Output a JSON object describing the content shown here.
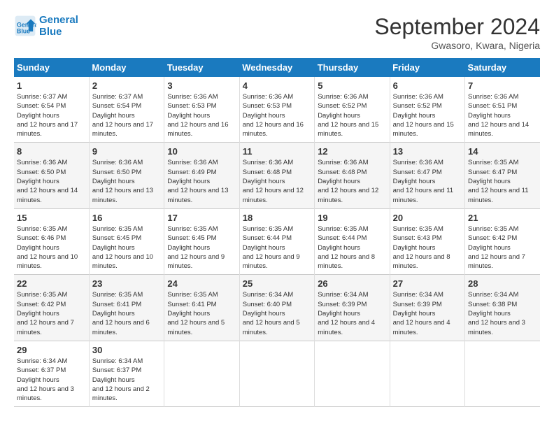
{
  "header": {
    "logo_line1": "General",
    "logo_line2": "Blue",
    "month": "September 2024",
    "location": "Gwasoro, Kwara, Nigeria"
  },
  "columns": [
    "Sunday",
    "Monday",
    "Tuesday",
    "Wednesday",
    "Thursday",
    "Friday",
    "Saturday"
  ],
  "weeks": [
    [
      {
        "day": "1",
        "sunrise": "6:37 AM",
        "sunset": "6:54 PM",
        "daylight": "12 hours and 17 minutes."
      },
      {
        "day": "2",
        "sunrise": "6:37 AM",
        "sunset": "6:54 PM",
        "daylight": "12 hours and 17 minutes."
      },
      {
        "day": "3",
        "sunrise": "6:36 AM",
        "sunset": "6:53 PM",
        "daylight": "12 hours and 16 minutes."
      },
      {
        "day": "4",
        "sunrise": "6:36 AM",
        "sunset": "6:53 PM",
        "daylight": "12 hours and 16 minutes."
      },
      {
        "day": "5",
        "sunrise": "6:36 AM",
        "sunset": "6:52 PM",
        "daylight": "12 hours and 15 minutes."
      },
      {
        "day": "6",
        "sunrise": "6:36 AM",
        "sunset": "6:52 PM",
        "daylight": "12 hours and 15 minutes."
      },
      {
        "day": "7",
        "sunrise": "6:36 AM",
        "sunset": "6:51 PM",
        "daylight": "12 hours and 14 minutes."
      }
    ],
    [
      {
        "day": "8",
        "sunrise": "6:36 AM",
        "sunset": "6:50 PM",
        "daylight": "12 hours and 14 minutes."
      },
      {
        "day": "9",
        "sunrise": "6:36 AM",
        "sunset": "6:50 PM",
        "daylight": "12 hours and 13 minutes."
      },
      {
        "day": "10",
        "sunrise": "6:36 AM",
        "sunset": "6:49 PM",
        "daylight": "12 hours and 13 minutes."
      },
      {
        "day": "11",
        "sunrise": "6:36 AM",
        "sunset": "6:48 PM",
        "daylight": "12 hours and 12 minutes."
      },
      {
        "day": "12",
        "sunrise": "6:36 AM",
        "sunset": "6:48 PM",
        "daylight": "12 hours and 12 minutes."
      },
      {
        "day": "13",
        "sunrise": "6:36 AM",
        "sunset": "6:47 PM",
        "daylight": "12 hours and 11 minutes."
      },
      {
        "day": "14",
        "sunrise": "6:35 AM",
        "sunset": "6:47 PM",
        "daylight": "12 hours and 11 minutes."
      }
    ],
    [
      {
        "day": "15",
        "sunrise": "6:35 AM",
        "sunset": "6:46 PM",
        "daylight": "12 hours and 10 minutes."
      },
      {
        "day": "16",
        "sunrise": "6:35 AM",
        "sunset": "6:45 PM",
        "daylight": "12 hours and 10 minutes."
      },
      {
        "day": "17",
        "sunrise": "6:35 AM",
        "sunset": "6:45 PM",
        "daylight": "12 hours and 9 minutes."
      },
      {
        "day": "18",
        "sunrise": "6:35 AM",
        "sunset": "6:44 PM",
        "daylight": "12 hours and 9 minutes."
      },
      {
        "day": "19",
        "sunrise": "6:35 AM",
        "sunset": "6:44 PM",
        "daylight": "12 hours and 8 minutes."
      },
      {
        "day": "20",
        "sunrise": "6:35 AM",
        "sunset": "6:43 PM",
        "daylight": "12 hours and 8 minutes."
      },
      {
        "day": "21",
        "sunrise": "6:35 AM",
        "sunset": "6:42 PM",
        "daylight": "12 hours and 7 minutes."
      }
    ],
    [
      {
        "day": "22",
        "sunrise": "6:35 AM",
        "sunset": "6:42 PM",
        "daylight": "12 hours and 7 minutes."
      },
      {
        "day": "23",
        "sunrise": "6:35 AM",
        "sunset": "6:41 PM",
        "daylight": "12 hours and 6 minutes."
      },
      {
        "day": "24",
        "sunrise": "6:35 AM",
        "sunset": "6:41 PM",
        "daylight": "12 hours and 5 minutes."
      },
      {
        "day": "25",
        "sunrise": "6:34 AM",
        "sunset": "6:40 PM",
        "daylight": "12 hours and 5 minutes."
      },
      {
        "day": "26",
        "sunrise": "6:34 AM",
        "sunset": "6:39 PM",
        "daylight": "12 hours and 4 minutes."
      },
      {
        "day": "27",
        "sunrise": "6:34 AM",
        "sunset": "6:39 PM",
        "daylight": "12 hours and 4 minutes."
      },
      {
        "day": "28",
        "sunrise": "6:34 AM",
        "sunset": "6:38 PM",
        "daylight": "12 hours and 3 minutes."
      }
    ],
    [
      {
        "day": "29",
        "sunrise": "6:34 AM",
        "sunset": "6:37 PM",
        "daylight": "12 hours and 3 minutes."
      },
      {
        "day": "30",
        "sunrise": "6:34 AM",
        "sunset": "6:37 PM",
        "daylight": "12 hours and 2 minutes."
      },
      null,
      null,
      null,
      null,
      null
    ]
  ]
}
